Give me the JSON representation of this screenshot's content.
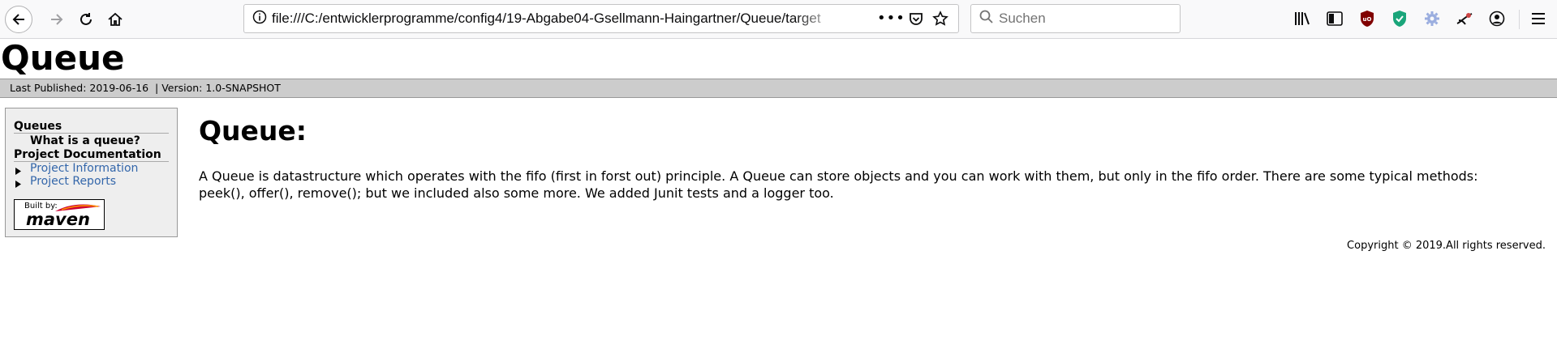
{
  "browser": {
    "url": "file:///C:/entwicklerprogramme/config4/19-Abgabe04-Gsellmann-Haingartner/Queue/target",
    "search_placeholder": "Suchen"
  },
  "page": {
    "title": "Queue",
    "banner": {
      "last_published": "Last Published: 2019-06-16",
      "separator": "|",
      "version": "Version: 1.0-SNAPSHOT"
    },
    "menu": {
      "section1": "Queues",
      "section1_item": "What is a queue?",
      "section2": "Project Documentation",
      "links": [
        "Project Information",
        "Project Reports"
      ]
    },
    "badge": {
      "built_by": "Built by:",
      "maven": "maven"
    },
    "main": {
      "heading": "Queue:",
      "paragraph": "A Queue is datastructure which operates with the fifo (first in forst out) principle. A Queue can store objects and you can work with them, but only in the fifo order. There are some typical methods: peek(), offer(), remove(); but we included also some more. We added Junit tests and a logger too."
    },
    "copyright": "Copyright © 2019.All rights reserved."
  }
}
